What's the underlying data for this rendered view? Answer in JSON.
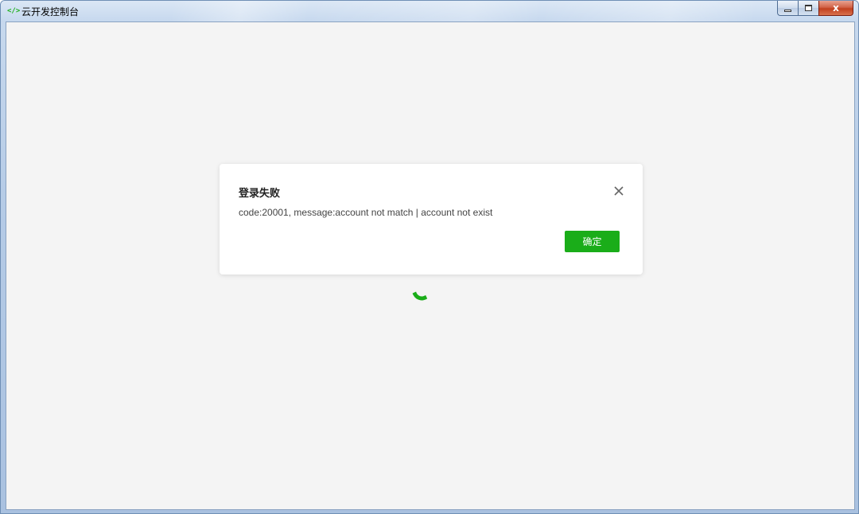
{
  "window": {
    "title": "云开发控制台",
    "app_icon": "code-brackets-icon",
    "controls": {
      "minimize_icon": "minimize-icon",
      "maximize_icon": "maximize-icon",
      "close_glyph": "x"
    }
  },
  "loading": {
    "icon": "spinner-icon",
    "color": "#1aad19"
  },
  "dialog": {
    "title": "登录失败",
    "message": "code:20001, message:account not match | account not exist",
    "close_icon": "close-icon",
    "confirm_label": "确定",
    "accent_color": "#1aad19"
  }
}
